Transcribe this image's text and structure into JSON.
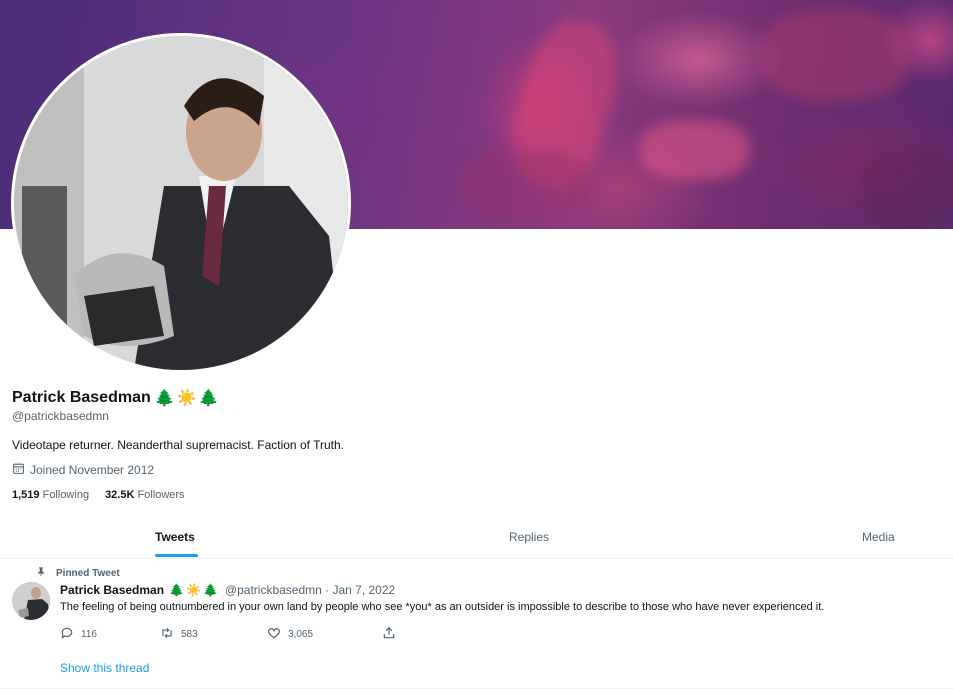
{
  "profile": {
    "name": "Patrick Basedman",
    "name_emojis": [
      "🌲",
      "☀️",
      "🌲"
    ],
    "handle": "@patrickbasedmn",
    "bio": "Videotape returner. Neanderthal supremacist. Faction of Truth.",
    "joined": "Joined November 2012",
    "following_count": "1,519",
    "following_label": "Following",
    "followers_count": "32.5K",
    "followers_label": "Followers"
  },
  "tabs": [
    {
      "label": "Tweets",
      "active": true
    },
    {
      "label": "Replies",
      "active": false
    },
    {
      "label": "Media",
      "active": false
    }
  ],
  "pinned_tweet": {
    "pinned_label": "Pinned Tweet",
    "author_name": "Patrick Basedman",
    "meta": "@patrickbasedmn · Jan 7, 2022",
    "text": "The feeling of being outnumbered in your own land by people who see *you* as an outsider is impossible to describe to those who have never experienced it.",
    "reply_count": "116",
    "retweet_count": "583",
    "like_count": "3,065",
    "thread_link": "Show this thread"
  },
  "colors": {
    "accent": "#1d9bf0",
    "secondary_text": "#536471",
    "primary_text": "#0f1419",
    "banner": "#6a3482"
  },
  "icons": {
    "pin": "pin-icon",
    "calendar": "calendar-icon",
    "reply": "reply-icon",
    "retweet": "retweet-icon",
    "like": "heart-icon",
    "share": "share-icon"
  }
}
